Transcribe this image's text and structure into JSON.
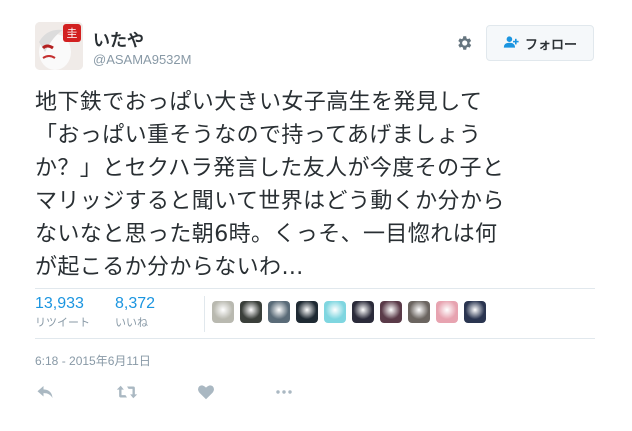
{
  "user": {
    "display_name": "いたや",
    "handle": "@ASAMA9532M"
  },
  "follow_button": {
    "label": "フォロー"
  },
  "tweet": {
    "lines": [
      "地下鉄でおっぱい大きい女子高生を発見して",
      "「おっぱい重そうなので持ってあげましょう",
      "か？」とセクハラ発言した友人が今度その子と",
      "マリッジすると聞いて世界はどう動くか分から",
      "ないなと思った朝6時。くっそ、一目惚れは何",
      "が起こるか分からないわ…"
    ]
  },
  "stats": {
    "retweets": {
      "count": "13,933",
      "label": "リツイート"
    },
    "likes": {
      "count": "8,372",
      "label": "いいね"
    }
  },
  "likers": [
    {
      "icon": "avatar-1",
      "color": "#b9b9b0"
    },
    {
      "icon": "avatar-2",
      "color": "#3a3f3a"
    },
    {
      "icon": "avatar-3",
      "color": "#5a6b78"
    },
    {
      "icon": "avatar-4",
      "color": "#1f2a33"
    },
    {
      "icon": "avatar-5",
      "color": "#7fd6e0"
    },
    {
      "icon": "avatar-6",
      "color": "#2b2b3a"
    },
    {
      "icon": "avatar-7",
      "color": "#5a3a48"
    },
    {
      "icon": "avatar-8",
      "color": "#6b6560"
    },
    {
      "icon": "avatar-9",
      "color": "#e7a3b0"
    },
    {
      "icon": "avatar-10",
      "color": "#2a3550"
    }
  ],
  "timestamp": "6:18 - 2015年6月11日",
  "actions": [
    "reply-icon",
    "retweet-icon",
    "like-icon",
    "more-icon"
  ],
  "colors": {
    "accent": "#1b95e0",
    "muted": "#8899a6",
    "text": "#292f33"
  }
}
